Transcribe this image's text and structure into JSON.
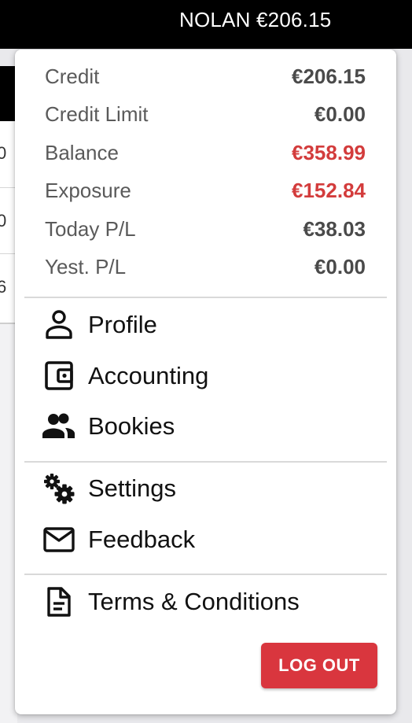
{
  "header": {
    "user_name": "NOLAN",
    "user_credit": "€206.15",
    "user_display": "NOLAN €206.15"
  },
  "background": {
    "row_fragments": [
      "0",
      "0",
      "6"
    ]
  },
  "account_summary": [
    {
      "label": "Credit",
      "value": "€206.15",
      "negative": false
    },
    {
      "label": "Credit Limit",
      "value": "€0.00",
      "negative": false
    },
    {
      "label": "Balance",
      "value": "€358.99",
      "negative": true
    },
    {
      "label": "Exposure",
      "value": "€152.84",
      "negative": true
    },
    {
      "label": "Today P/L",
      "value": "€38.03",
      "negative": false
    },
    {
      "label": "Yest. P/L",
      "value": "€0.00",
      "negative": false
    }
  ],
  "menu": {
    "profile": {
      "label": "Profile",
      "icon": "person-icon"
    },
    "accounting": {
      "label": "Accounting",
      "icon": "wallet-icon"
    },
    "bookies": {
      "label": "Bookies",
      "icon": "people-icon"
    },
    "settings": {
      "label": "Settings",
      "icon": "gears-icon"
    },
    "feedback": {
      "label": "Feedback",
      "icon": "mail-icon"
    },
    "terms": {
      "label": "Terms & Conditions",
      "icon": "document-icon"
    }
  },
  "logout_label": "LOG OUT",
  "colors": {
    "header_bg": "#000000",
    "negative_value": "#d33c3c",
    "logout_button": "#d9363e",
    "text_primary": "#111111",
    "text_secondary": "#5a5a5a"
  }
}
